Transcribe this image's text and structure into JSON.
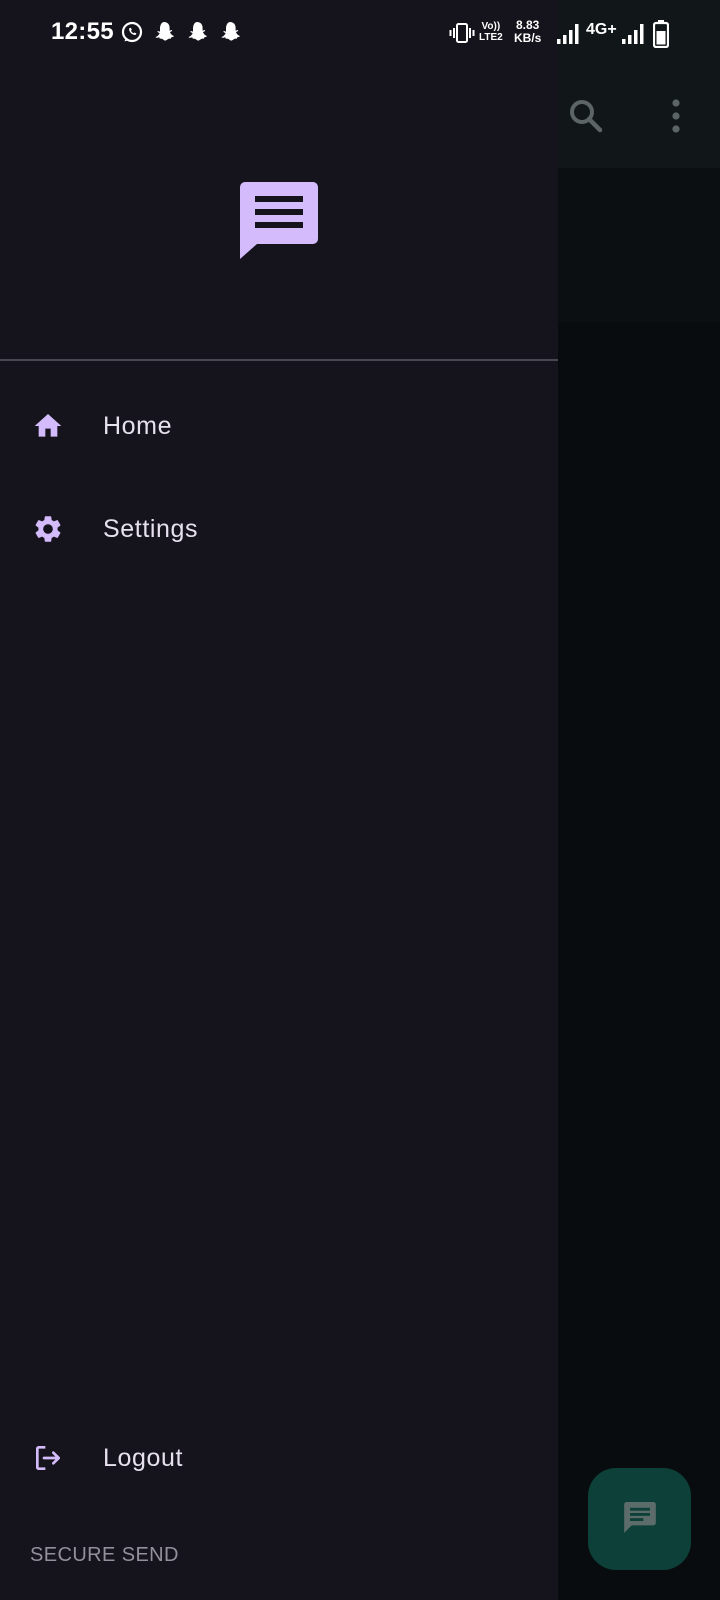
{
  "status_bar": {
    "time": "12:55",
    "notification_icons": [
      "whatsapp-icon",
      "snapchat-icon",
      "snapchat-icon",
      "snapchat-icon"
    ],
    "volte_line1": "Vo))",
    "volte_line2": "LTE2",
    "speed_value": "8.83",
    "speed_unit": "KB/s",
    "network": "4G+"
  },
  "drawer": {
    "logo_icon": "message-icon",
    "items": [
      {
        "label": "Home",
        "icon": "home-icon"
      },
      {
        "label": "Settings",
        "icon": "gear-icon"
      }
    ],
    "logout": {
      "label": "Logout",
      "icon": "logout-icon"
    },
    "footer": "SECURE SEND"
  },
  "background_app": {
    "toolbar_icons": [
      "search-icon",
      "more-vert-icon"
    ],
    "fab_icon": "message-icon"
  },
  "colors": {
    "drawer_bg": "#15131b",
    "accent": "#d4bbfb",
    "text": "#e7e1ee",
    "footer_text": "#948f9c",
    "fab": "#0c4038"
  }
}
